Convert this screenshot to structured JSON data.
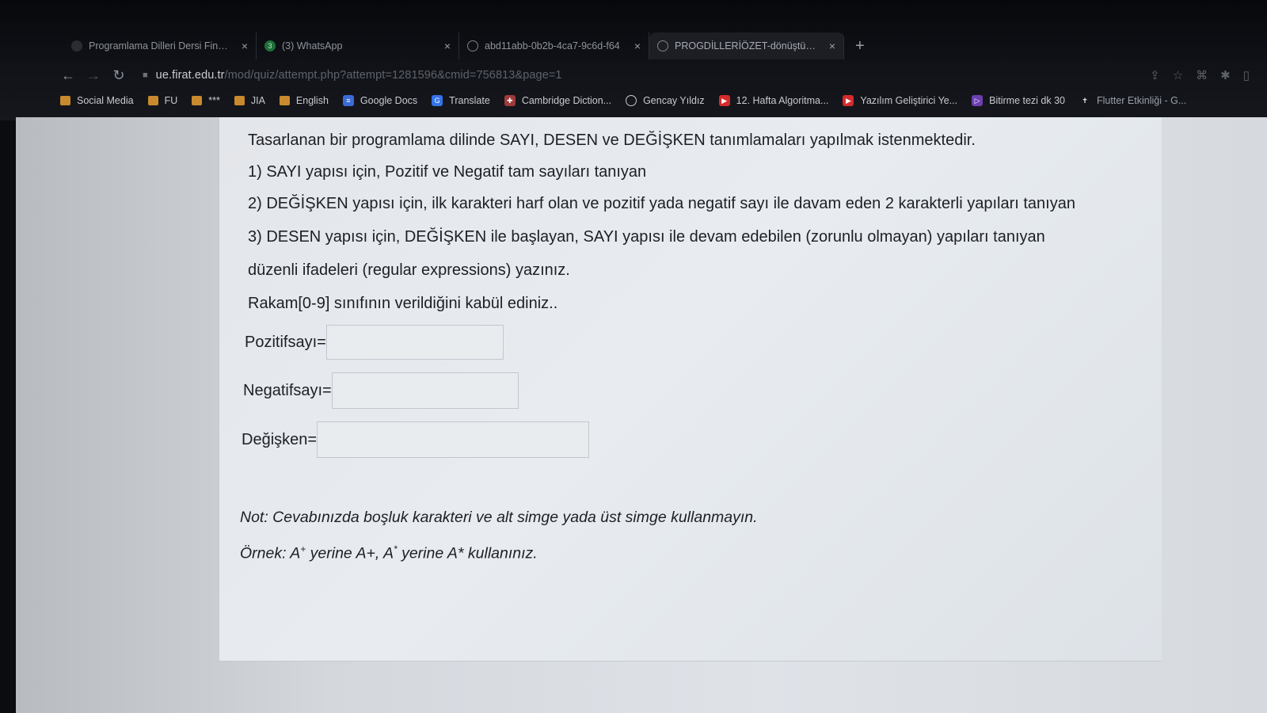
{
  "browser": {
    "tabs": [
      {
        "label": "Programlama Dilleri Dersi Final S",
        "close": "×",
        "icon": "dark-favicon"
      },
      {
        "label": "(3) WhatsApp",
        "close": "×",
        "icon": "whatsapp-icon",
        "badge": "3"
      },
      {
        "label": "abd11abb-0b2b-4ca7-9c6d-f64",
        "close": "×",
        "icon": "globe-icon"
      },
      {
        "label": "PROGDİLLERİÖZET-dönüştürüld",
        "close": "×",
        "icon": "globe-icon"
      }
    ],
    "new_tab": "+",
    "url_host": "ue.firat.edu.tr",
    "url_path": "/mod/quiz/attempt.php?attempt=1281596&cmid=756813&page=1",
    "bookmarks": [
      {
        "label": "Social Media",
        "icon": "folder-icon"
      },
      {
        "label": "FU",
        "icon": "folder-icon"
      },
      {
        "label": "***",
        "icon": "folder-icon"
      },
      {
        "label": "JIA",
        "icon": "folder-icon"
      },
      {
        "label": "English",
        "icon": "folder-icon"
      },
      {
        "label": "Google Docs",
        "icon": "google-docs-icon"
      },
      {
        "label": "Translate",
        "icon": "translate-icon"
      },
      {
        "label": "Cambridge Diction...",
        "icon": "cambridge-icon"
      },
      {
        "label": "Gencay Yıldız",
        "icon": "globe-icon"
      },
      {
        "label": "12. Hafta Algoritma...",
        "icon": "youtube-icon"
      },
      {
        "label": "Yazılım Geliştirici Ye...",
        "icon": "youtube-icon"
      },
      {
        "label": "Bitirme tezi dk 30",
        "icon": "purple-icon"
      },
      {
        "label": "Flutter Etkinliği - G...",
        "icon": "cross-icon"
      }
    ]
  },
  "question": {
    "intro": "Tasarlanan bir programlama dilinde SAYI, DESEN ve DEĞİŞKEN tanımlamaları yapılmak istenmektedir.",
    "item1": "1) SAYI yapısı için, Pozitif ve Negatif tam sayıları tanıyan",
    "item2": "2) DEĞİŞKEN yapısı için, ilk karakteri harf olan ve pozitif yada negatif sayı ile davam eden 2 karakterli yapıları tanıyan",
    "item3": "3) DESEN yapısı için, DEĞİŞKEN ile başlayan, SAYI yapısı ile devam edebilen (zorunlu olmayan) yapıları tanıyan",
    "line4": "düzenli ifadeleri (regular expressions) yazınız.",
    "line5": "Rakam[0-9] sınıfının verildiğini kabül ediniz.."
  },
  "fields": {
    "positive_label": "Pozitifsayı=",
    "positive_value": "",
    "negative_label": "Negatifsayı=",
    "negative_value": "",
    "variable_label": "Değişken=",
    "variable_value": ""
  },
  "notes": {
    "note": "Not: Cevabınızda boşluk karakteri ve alt simge yada üst simge kullanmayın.",
    "example_prefix": "Örnek: A",
    "example_sup1": "+",
    "example_mid": " yerine A+,  A",
    "example_sup2": "*",
    "example_suffix": " yerine A* kullanınız."
  }
}
